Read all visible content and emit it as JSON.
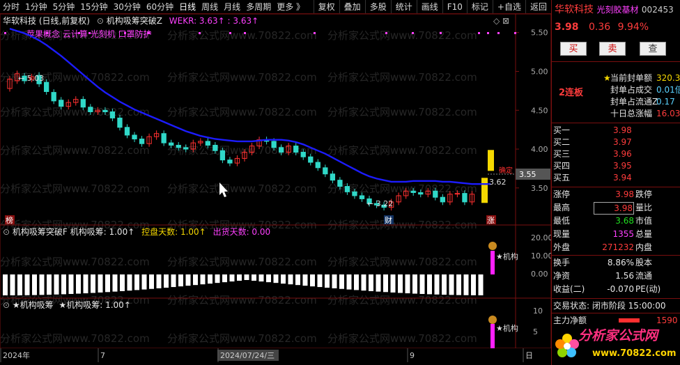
{
  "toolbar": {
    "periods": [
      "分时",
      "1分钟",
      "5分钟",
      "15分钟",
      "30分钟",
      "60分钟",
      "日线",
      "周线",
      "月线",
      "多周期",
      "更多 》"
    ],
    "active_period": "日线",
    "tools": [
      "复权",
      "叠加",
      "多股",
      "统计",
      "画线",
      "F10",
      "标记",
      "+自选",
      "返回"
    ]
  },
  "main_chart": {
    "title_stock": "华软科技 (日线,前复权)",
    "indicator_name": "机构吸筹突破Z",
    "indicator_value": "WEKR: 3.63↑  : 3.63↑",
    "concept_tags": "苹果概念 云计算 光刻机 口罩防护",
    "y_ticks": [
      "5.50",
      "5.00",
      "4.50",
      "4.00",
      "3.50"
    ],
    "high_label": "5.03",
    "low_label": "3.22",
    "current_label": "3.62",
    "cursor_price": "3.55",
    "annot_bang": "榜",
    "annot_cai": "财",
    "annot_zhang": "涨",
    "annot_short": "确定"
  },
  "sub1": {
    "name": "机构吸筹突破F",
    "v1": "机构吸筹: 1.00↑",
    "v2": "控盘天数: 1.00↑",
    "v3": "出货天数: 0.00",
    "y_ticks": [
      "20.00",
      "10.00",
      "0.00"
    ],
    "signal_label": "★机构"
  },
  "sub2": {
    "name": "★机构吸筹",
    "v1": "★机构吸筹: 1.00↑",
    "y_ticks": [
      "10",
      "5"
    ],
    "signal_label": "★机构"
  },
  "x_axis": {
    "labels": [
      "2024年",
      "7",
      "2024/07/24/三",
      "9",
      "日"
    ]
  },
  "right_panel": {
    "stock_name": "华软科技",
    "stock_tag": "光刻胶基材",
    "stock_code": "002453",
    "price": "3.98",
    "change": "0.36",
    "change_pct": "9.94%",
    "buttons": [
      "买",
      "卖",
      "查"
    ],
    "limit_up_days": "2连板",
    "seal_rows": [
      {
        "label": "当前封单额",
        "value": "320.3"
      },
      {
        "label": "封单占成交",
        "value": "0.01倍"
      },
      {
        "label": "封单占流通Z",
        "value": "0.17"
      },
      {
        "label": "十日总涨幅",
        "value": "16.03"
      }
    ],
    "bid_rows": [
      {
        "label": "买一",
        "price": "3.98"
      },
      {
        "label": "买二",
        "price": "3.97"
      },
      {
        "label": "买三",
        "price": "3.96"
      },
      {
        "label": "买四",
        "price": "3.95"
      },
      {
        "label": "买五",
        "price": "3.94"
      }
    ],
    "stats": [
      {
        "l1": "涨停",
        "v1": "3.98",
        "l2": "跌停"
      },
      {
        "l1": "最高",
        "v1": "3.98",
        "l2": "量比"
      },
      {
        "l1": "最低",
        "v1": "3.68",
        "l2": "市值"
      },
      {
        "l1": "现量",
        "v1": "1355",
        "l2": "总量"
      },
      {
        "l1": "外盘",
        "v1": "271232",
        "l2": "内盘"
      }
    ],
    "stats2": [
      {
        "l1": "换手",
        "v1": "8.86%",
        "l2": "股本"
      },
      {
        "l1": "净资",
        "v1": "1.56",
        "l2": "流通"
      },
      {
        "l1": "收益(二)",
        "v1": "-0.070",
        "l2": "PE(动)"
      }
    ],
    "trade_status": "交易状态: 闭市阶段 15:00:00",
    "main_net": "主力净额",
    "main_net_value": "1590",
    "logo_text": "分析家公式网",
    "logo_url": "www.70822.com"
  },
  "watermark": "分析家公式网www.70822.com",
  "chart_data": {
    "type": "candlestick",
    "closes": [
      4.9,
      4.97,
      4.88,
      4.93,
      4.84,
      4.74,
      4.62,
      4.55,
      4.6,
      4.64,
      4.54,
      4.48,
      4.5,
      4.48,
      4.4,
      4.28,
      4.18,
      4.13,
      4.07,
      4.16,
      4.2,
      4.08,
      4.05,
      4.02,
      4.0,
      4.08,
      4.1,
      4.05,
      3.98,
      3.86,
      3.82,
      3.88,
      3.96,
      4.04,
      4.12,
      4.1,
      4.02,
      3.96,
      4.04,
      3.96,
      3.9,
      3.83,
      3.76,
      3.68,
      3.6,
      3.52,
      3.45,
      3.4,
      3.36,
      3.3,
      3.28,
      3.25,
      3.32,
      3.4,
      3.46,
      3.44,
      3.42,
      3.46,
      3.38,
      3.32,
      3.42,
      3.43,
      3.32,
      3.42
    ],
    "opens": [
      4.78,
      4.88,
      4.94,
      4.9,
      4.95,
      4.86,
      4.73,
      4.63,
      4.55,
      4.6,
      4.64,
      4.54,
      4.48,
      4.5,
      4.48,
      4.4,
      4.28,
      4.18,
      4.13,
      4.07,
      4.16,
      4.2,
      4.08,
      4.05,
      4.02,
      4.0,
      4.08,
      4.1,
      4.05,
      3.98,
      3.86,
      3.82,
      3.88,
      3.96,
      4.04,
      4.12,
      4.1,
      4.02,
      3.96,
      4.04,
      3.96,
      3.9,
      3.83,
      3.76,
      3.68,
      3.6,
      3.52,
      3.45,
      3.4,
      3.36,
      3.3,
      3.28,
      3.25,
      3.32,
      3.4,
      3.46,
      3.44,
      3.42,
      3.46,
      3.38,
      3.32,
      3.42,
      3.43,
      3.32
    ],
    "ma": [
      5.55,
      5.52,
      5.49,
      5.45,
      5.4,
      5.34,
      5.27,
      5.2,
      5.12,
      5.04,
      4.96,
      4.88,
      4.8,
      4.73,
      4.67,
      4.61,
      4.56,
      4.51,
      4.47,
      4.43,
      4.39,
      4.35,
      4.31,
      4.27,
      4.23,
      4.2,
      4.17,
      4.15,
      4.13,
      4.12,
      4.11,
      4.1,
      4.1,
      4.1,
      4.11,
      4.12,
      4.12,
      4.12,
      4.11,
      4.09,
      4.06,
      4.02,
      3.98,
      3.94,
      3.89,
      3.84,
      3.79,
      3.74,
      3.69,
      3.65,
      3.62,
      3.6,
      3.58,
      3.58,
      3.58,
      3.59,
      3.59,
      3.59,
      3.59,
      3.58,
      3.58,
      3.57,
      3.56,
      3.55
    ],
    "last_open": 3.43,
    "last_close": 3.63,
    "ylim": [
      3.05,
      5.65
    ]
  }
}
